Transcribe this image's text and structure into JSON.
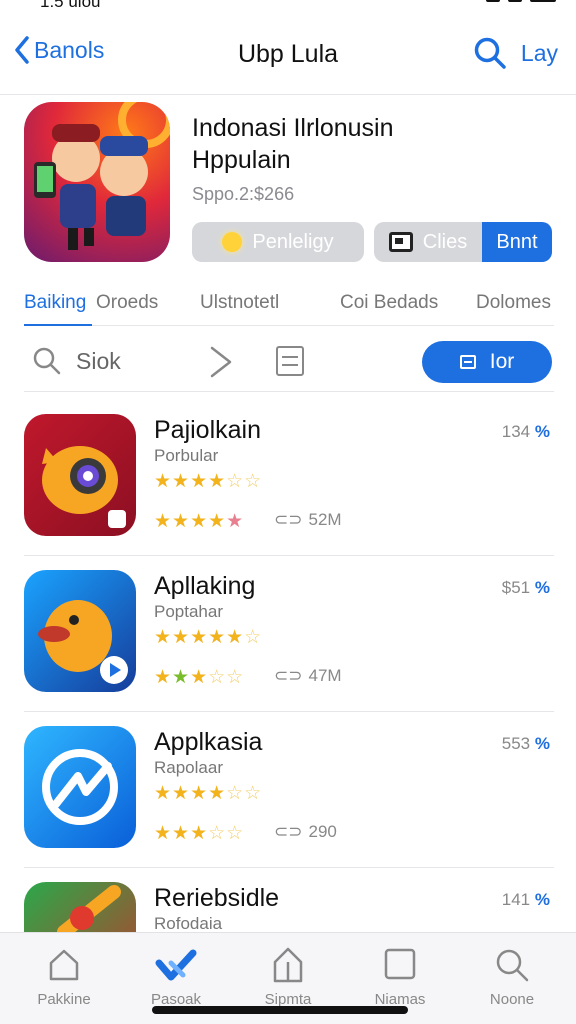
{
  "status": {
    "time": "1:5 ulou"
  },
  "nav": {
    "back_label": "Banols",
    "title": "Ubp Lula",
    "right_label": "Lay"
  },
  "hero": {
    "title_line1": "Indonasi Ilrlonusin",
    "title_line2": "Hppulain",
    "price": "Sppo.2:$266",
    "get_label": "Penleligy",
    "cloud_label": "Clies",
    "buy_label": "Bnnt"
  },
  "tabs": [
    {
      "label": "Baiking"
    },
    {
      "label": "Oroeds"
    },
    {
      "label": "Ulstnotetl"
    },
    {
      "label": "Coi Bedads"
    },
    {
      "label": "Dolomes"
    }
  ],
  "toolbar": {
    "search_label": "Siok",
    "action_label": "Ior"
  },
  "apps": [
    {
      "name": "Pajiolkain",
      "subtitle": "Porbular",
      "price": "134",
      "pct": "%",
      "downloads": "52M",
      "rating1": 4.5,
      "rating2": 4.5
    },
    {
      "name": "Apllaking",
      "subtitle": "Poptahar",
      "price": "$51",
      "pct": "%",
      "downloads": "47M",
      "rating1": 4.5,
      "rating2": 3.5
    },
    {
      "name": "Applkasia",
      "subtitle": "Rapolaar",
      "price": "553",
      "pct": "%",
      "downloads": "290",
      "rating1": 4.5,
      "rating2": 3
    },
    {
      "name": "Reriebsidle",
      "subtitle": "Rofodaia",
      "price": "141",
      "pct": "%"
    }
  ],
  "bottom_tabs": [
    {
      "label": "Pakkine"
    },
    {
      "label": "Pasoak"
    },
    {
      "label": "Sipmta"
    },
    {
      "label": "Niamas"
    },
    {
      "label": "Noone"
    }
  ],
  "colors": {
    "accent": "#1e6fe0",
    "star": "#f2b31c"
  }
}
